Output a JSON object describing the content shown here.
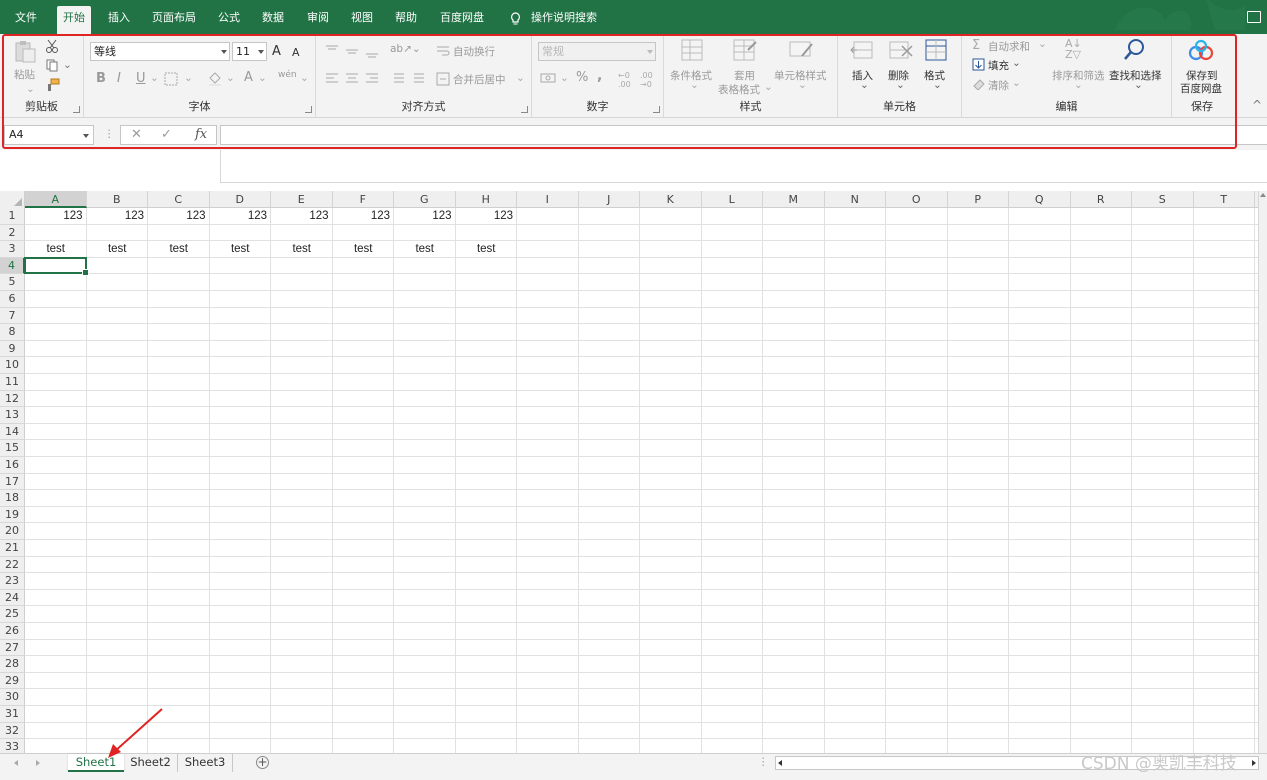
{
  "tabs": [
    "文件",
    "开始",
    "插入",
    "页面布局",
    "公式",
    "数据",
    "审阅",
    "视图",
    "帮助",
    "百度网盘"
  ],
  "tell_me": "操作说明搜索",
  "clipboard": {
    "paste": "粘贴",
    "label": "剪贴板"
  },
  "font": {
    "name": "等线",
    "size": "11",
    "label": "字体",
    "grow": "A",
    "shrink": "A",
    "bold": "B",
    "italic": "I",
    "underline": "U",
    "color_a": "A",
    "phonetic": "wén"
  },
  "alignment": {
    "wrap": "自动换行",
    "merge": "合并后居中",
    "label": "对齐方式"
  },
  "number": {
    "format": "常规",
    "label": "数字",
    "percent": "%",
    "comma": ","
  },
  "styles": {
    "conditional": "条件格式",
    "table_a": "套用",
    "table_b": "表格格式",
    "cell_styles": "单元格样式",
    "label": "样式"
  },
  "cells": {
    "insert": "插入",
    "delete": "删除",
    "format": "格式",
    "label": "单元格"
  },
  "editing": {
    "autosum": "自动求和",
    "fill": "填充",
    "clear": "清除",
    "sort": "排序和筛选",
    "find": "查找和选择",
    "label": "编辑"
  },
  "save": {
    "line1": "保存到",
    "line2": "百度网盘",
    "label": "保存"
  },
  "formula_bar": {
    "name_box": "A4",
    "cancel": "✕",
    "enter": "✓",
    "fx": "fx",
    "value": ""
  },
  "columns": [
    "A",
    "B",
    "C",
    "D",
    "E",
    "F",
    "G",
    "H",
    "I",
    "J",
    "K",
    "L",
    "M",
    "N",
    "O",
    "P",
    "Q",
    "R",
    "S",
    "T"
  ],
  "rows": [
    "1",
    "2",
    "3",
    "4",
    "5",
    "6",
    "7",
    "8",
    "9",
    "10",
    "11",
    "12",
    "13",
    "14",
    "15",
    "16",
    "17",
    "18",
    "19",
    "20",
    "21",
    "22",
    "23",
    "24",
    "25",
    "26",
    "27",
    "28",
    "29",
    "30",
    "31",
    "32",
    "33"
  ],
  "cells_data": {
    "row1": [
      "123",
      "123",
      "123",
      "123",
      "123",
      "123",
      "123",
      "123"
    ],
    "row3": [
      "test",
      "test",
      "test",
      "test",
      "test",
      "test",
      "test",
      "test"
    ]
  },
  "active_cell": "A4",
  "sheets": [
    "Sheet1",
    "Sheet2",
    "Sheet3"
  ],
  "add_sheet": "+",
  "watermark": "CSDN @奥凯丰科技",
  "colors": {
    "brand": "#217346",
    "highlight": "#e02424"
  }
}
